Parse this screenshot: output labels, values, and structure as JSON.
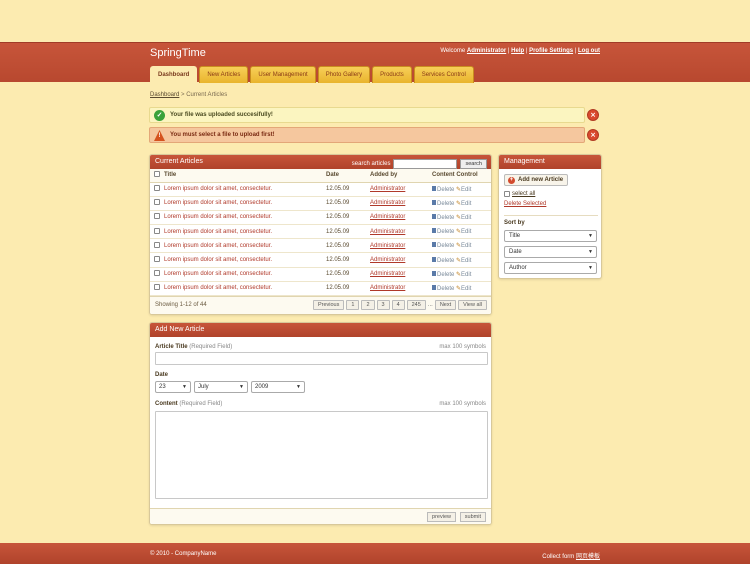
{
  "app": {
    "brand": "SpringTime"
  },
  "topnav": {
    "welcome_prefix": "Welcome",
    "username": "Administrator",
    "help": "Help",
    "profile_settings": "Profile Settings",
    "logout": "Log out",
    "sep": "|"
  },
  "tabs": [
    {
      "label": "Dashboard",
      "active": true
    },
    {
      "label": "New Articles"
    },
    {
      "label": "User Management"
    },
    {
      "label": "Photo Gallery"
    },
    {
      "label": "Products"
    },
    {
      "label": "Services Control"
    }
  ],
  "breadcrumb": {
    "root": "Dashboard",
    "sep": ">",
    "current": "Current Articles"
  },
  "alerts": {
    "success": "Your file was uploaded succesifully!",
    "error": "You must select a file to upload first!"
  },
  "articles": {
    "title": "Current Articles",
    "search_label": "search articles",
    "search_value": "",
    "search_button": "search",
    "columns": [
      "Title",
      "Date",
      "Added by",
      "Content Control"
    ],
    "rows": [
      {
        "title": "Lorem ipsum dolor sit amet, consectetur.",
        "date": "12.05.09",
        "user": "Administrator"
      },
      {
        "title": "Lorem ipsum dolor sit amet, consectetur.",
        "date": "12.05.09",
        "user": "Administrator"
      },
      {
        "title": "Lorem ipsum dolor sit amet, consectetur.",
        "date": "12.05.09",
        "user": "Administrator"
      },
      {
        "title": "Lorem ipsum dolor sit amet, consectetur.",
        "date": "12.05.09",
        "user": "Administrator"
      },
      {
        "title": "Lorem ipsum dolor sit amet, consectetur.",
        "date": "12.05.09",
        "user": "Administrator"
      },
      {
        "title": "Lorem ipsum dolor sit amet, consectetur.",
        "date": "12.05.09",
        "user": "Administrator"
      },
      {
        "title": "Lorem ipsum dolor sit amet, consectetur.",
        "date": "12.05.09",
        "user": "Administrator"
      },
      {
        "title": "Lorem ipsum dolor sit amet, consectetur.",
        "date": "12.05.09",
        "user": "Administrator"
      }
    ],
    "delete_label": "Delete",
    "edit_label": "Edit",
    "showing": "Showing 1-12 of 44",
    "pager": {
      "previous": "Previous",
      "pages": [
        "1",
        "2",
        "3",
        "4",
        "245"
      ],
      "ellipsis": "...",
      "next": "Next",
      "view_all": "View all"
    }
  },
  "management": {
    "title": "Management",
    "add_new": "Add new Article",
    "select_all": "select all",
    "delete_selected": "Delete Selected",
    "sort_by": "Sort by",
    "sorts": [
      "Title",
      "Date",
      "Author"
    ]
  },
  "new_article": {
    "title": "Add New Article",
    "article_title_label": "Article Title",
    "required": "(Required Field)",
    "max_hint": "max 100 symbols",
    "date_label": "Date",
    "day": "23",
    "month": "July",
    "year": "2009",
    "content_label": "Content",
    "preview": "preview",
    "submit": "submit"
  },
  "footer": {
    "copyright": "© 2010 - CompanyName",
    "collect_text": "Collect form",
    "collect_link": "网页模板"
  },
  "colors": {
    "header": "#c7553a",
    "background": "#fcebb0",
    "tab": "#f0c040",
    "link": "#b0392a"
  }
}
